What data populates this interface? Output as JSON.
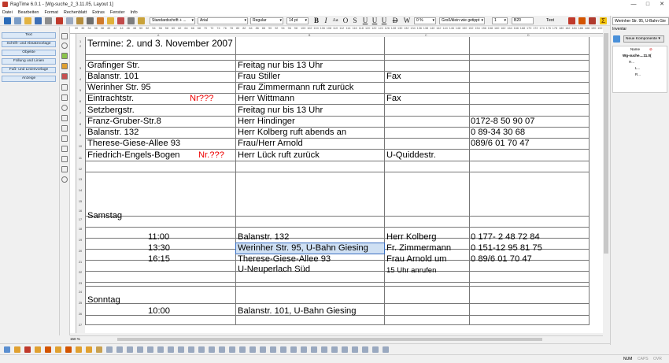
{
  "window": {
    "title": "RagTime 6.0.1 - [Wg-suche_2_3.11.05, Layout 1]"
  },
  "menu": [
    "Datei",
    "Bearbeiten",
    "Format",
    "Rechenblatt",
    "Extras",
    "Fenster",
    "Info"
  ],
  "toolbar": {
    "style_combo": "Standardschrift + ...",
    "font_combo": "Arial",
    "weight_combo": "Regular",
    "size_combo": "14 pt",
    "percent_combo": "0 %",
    "case_combo": "Groß/klein wie getippt",
    "number_combo": "1",
    "cell_ref": "B20",
    "text_label": "Text"
  },
  "left_panel": [
    "Text",
    "Schrift- und Absatzvorlage",
    "Objekte",
    "Füllung und Linien",
    "Fuß- und Linienvorlage",
    "Anzeige"
  ],
  "ruler_h": [
    "30",
    "32",
    "34",
    "36",
    "38",
    "40",
    "42",
    "44",
    "46",
    "48",
    "50",
    "52",
    "54",
    "56",
    "58",
    "60",
    "62",
    "64",
    "66",
    "68",
    "70",
    "72",
    "74",
    "76",
    "78",
    "80",
    "82",
    "84",
    "86",
    "88",
    "90",
    "92",
    "94",
    "96",
    "98",
    "100",
    "102",
    "104",
    "106",
    "108",
    "110",
    "112",
    "114",
    "116",
    "118",
    "120",
    "122",
    "124",
    "126",
    "128",
    "130",
    "132",
    "134",
    "136",
    "138",
    "140",
    "142",
    "144",
    "146",
    "148",
    "150",
    "152",
    "154",
    "156",
    "158",
    "160",
    "162",
    "164",
    "166",
    "168",
    "170",
    "172",
    "174",
    "176",
    "178",
    "180",
    "182",
    "184",
    "186",
    "188",
    "190",
    "192",
    "194"
  ],
  "col_labels": [
    "A",
    "B",
    "C",
    "D"
  ],
  "row_numbers": [
    "1",
    "2",
    "3",
    "4",
    "5",
    "6",
    "7",
    "8",
    "9",
    "10",
    "11",
    "12",
    "13",
    "14",
    "15",
    "16",
    "17",
    "18",
    "19",
    "20",
    "21",
    "22",
    "23",
    "24",
    "25",
    "26",
    "27"
  ],
  "sheet": {
    "title": "Termine: 2. und 3. November 2007",
    "rows": [
      {
        "a": "Grafinger Str.",
        "a_red": "",
        "b": "Freitag nur bis 13 Uhr",
        "c": "",
        "d": ""
      },
      {
        "a": "Balanstr. 101",
        "a_red": "",
        "b": "Frau Stiller",
        "c": "Fax",
        "d": ""
      },
      {
        "a": "Werinher Str.  95",
        "a_red": "",
        "b": "Frau Zimmermann ruft zurück",
        "c": "",
        "d": ""
      },
      {
        "a": "Eintrachtstr.",
        "a_red": "Nr???",
        "b": "Herr Wittmann",
        "c": "Fax",
        "d": ""
      },
      {
        "a": "Setzbergstr.",
        "a_red": "",
        "b": "Freitag nur bis 13 Uhr",
        "c": "",
        "d": ""
      },
      {
        "a": "Franz-Gruber-Str.8",
        "a_red": "",
        "b": "Herr Hindinger",
        "c": "",
        "d": "0172-8 50 90 07"
      },
      {
        "a": "Balanstr. 132",
        "a_red": "",
        "b": "Herr Kolberg ruft abends an",
        "c": "",
        "d": "0 89-34 30 68"
      },
      {
        "a": "Therese-Giese-Allee 93",
        "a_red": "",
        "b": "Frau/Herr Arnold",
        "c": "",
        "d": "089/6 01 70 47"
      },
      {
        "a": "Friedrich-Engels-Bogen",
        "a_red": "Nr.???",
        "b": "Herr Lück ruft zurück",
        "c": "U-Quiddestr.",
        "d": ""
      }
    ],
    "samstag_label": "Samstag",
    "samstag": [
      {
        "time": "11:00",
        "b": "Balanstr. 132",
        "c": "Herr Kolberg",
        "d": "0 177- 2 48 72 84"
      },
      {
        "time": "13:30",
        "b": "Werinher Str. 95, U-Bahn Giesing",
        "c": "Fr. Zimmermann",
        "d": "0 151-12 95 81 75"
      },
      {
        "time": "16:15",
        "b": "Therese-Giese-Allee 93",
        "c": "Frau Arnold um",
        "d": "0 89/6 01 70 47"
      }
    ],
    "samstag_extra_b": "U-Neuperlach Süd",
    "samstag_extra_c": "15 Uhr anrufen",
    "sonntag_label": "Sonntag",
    "sonntag": [
      {
        "time": "10:00",
        "b": "Balanstr. 101, U-Bahn Giesing",
        "c": "",
        "d": ""
      }
    ]
  },
  "right_panel": {
    "field": "Werinher Str. 95, U-Bahn Gie",
    "inventar_label": "Inventar",
    "new_component": "Neue Komponente",
    "name_col": "Name",
    "tree": [
      "Wg-suche....11.0(",
      "H...",
      "L...",
      "R..."
    ]
  },
  "hbar": {
    "zoom": "150 %"
  },
  "status": {
    "num": "NUM",
    "caps": "CAPS",
    "ovr": "OVR"
  }
}
